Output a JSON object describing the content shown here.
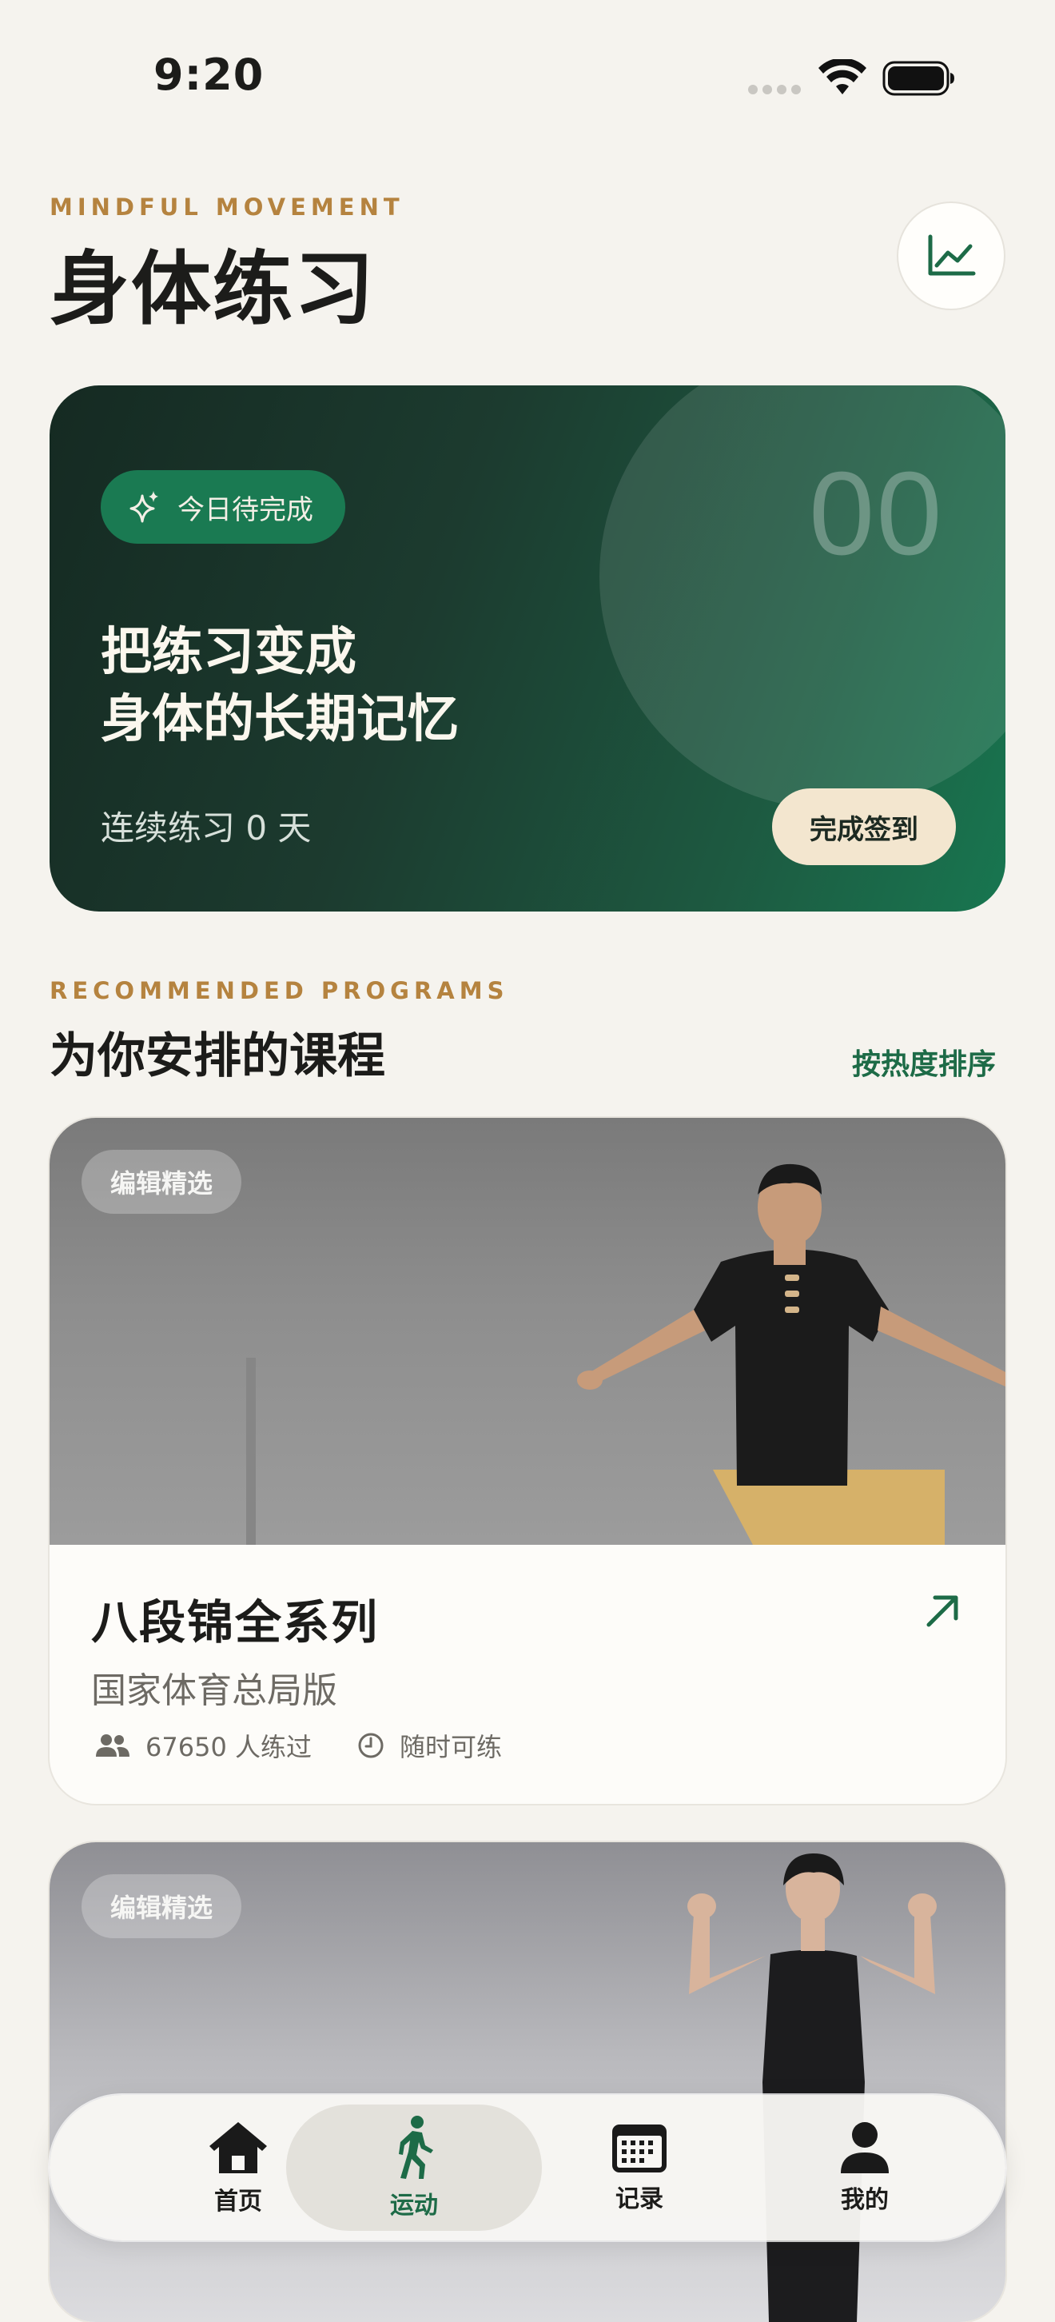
{
  "status_bar": {
    "time": "9:20"
  },
  "header": {
    "eyebrow": "MINDFUL MOVEMENT",
    "title": "身体练习",
    "stats_icon": "chart-line-icon"
  },
  "hero": {
    "pill_label": "今日待完成",
    "big_number": "00",
    "title_line1": "把练习变成",
    "title_line2": "身体的长期记忆",
    "streak": "连续练习 0 天",
    "checkin_label": "完成签到"
  },
  "section": {
    "eyebrow": "RECOMMENDED PROGRAMS",
    "title": "为你安排的课程",
    "sort_label": "按热度排序"
  },
  "programs": [
    {
      "badge": "编辑精选",
      "title": "八段锦全系列",
      "subtitle": "国家体育总局版",
      "practitioners": "67650 人练过",
      "availability": "随时可练"
    },
    {
      "badge": "编辑精选"
    }
  ],
  "tabbar": {
    "tabs": [
      {
        "label": "首页",
        "icon": "home-icon"
      },
      {
        "label": "运动",
        "icon": "walking-icon",
        "active": true
      },
      {
        "label": "记录",
        "icon": "calendar-icon"
      },
      {
        "label": "我的",
        "icon": "person-icon"
      }
    ]
  },
  "colors": {
    "accent_green": "#1d6b47",
    "eyebrow_gold": "#b5833f",
    "background": "#f5f3ee"
  }
}
